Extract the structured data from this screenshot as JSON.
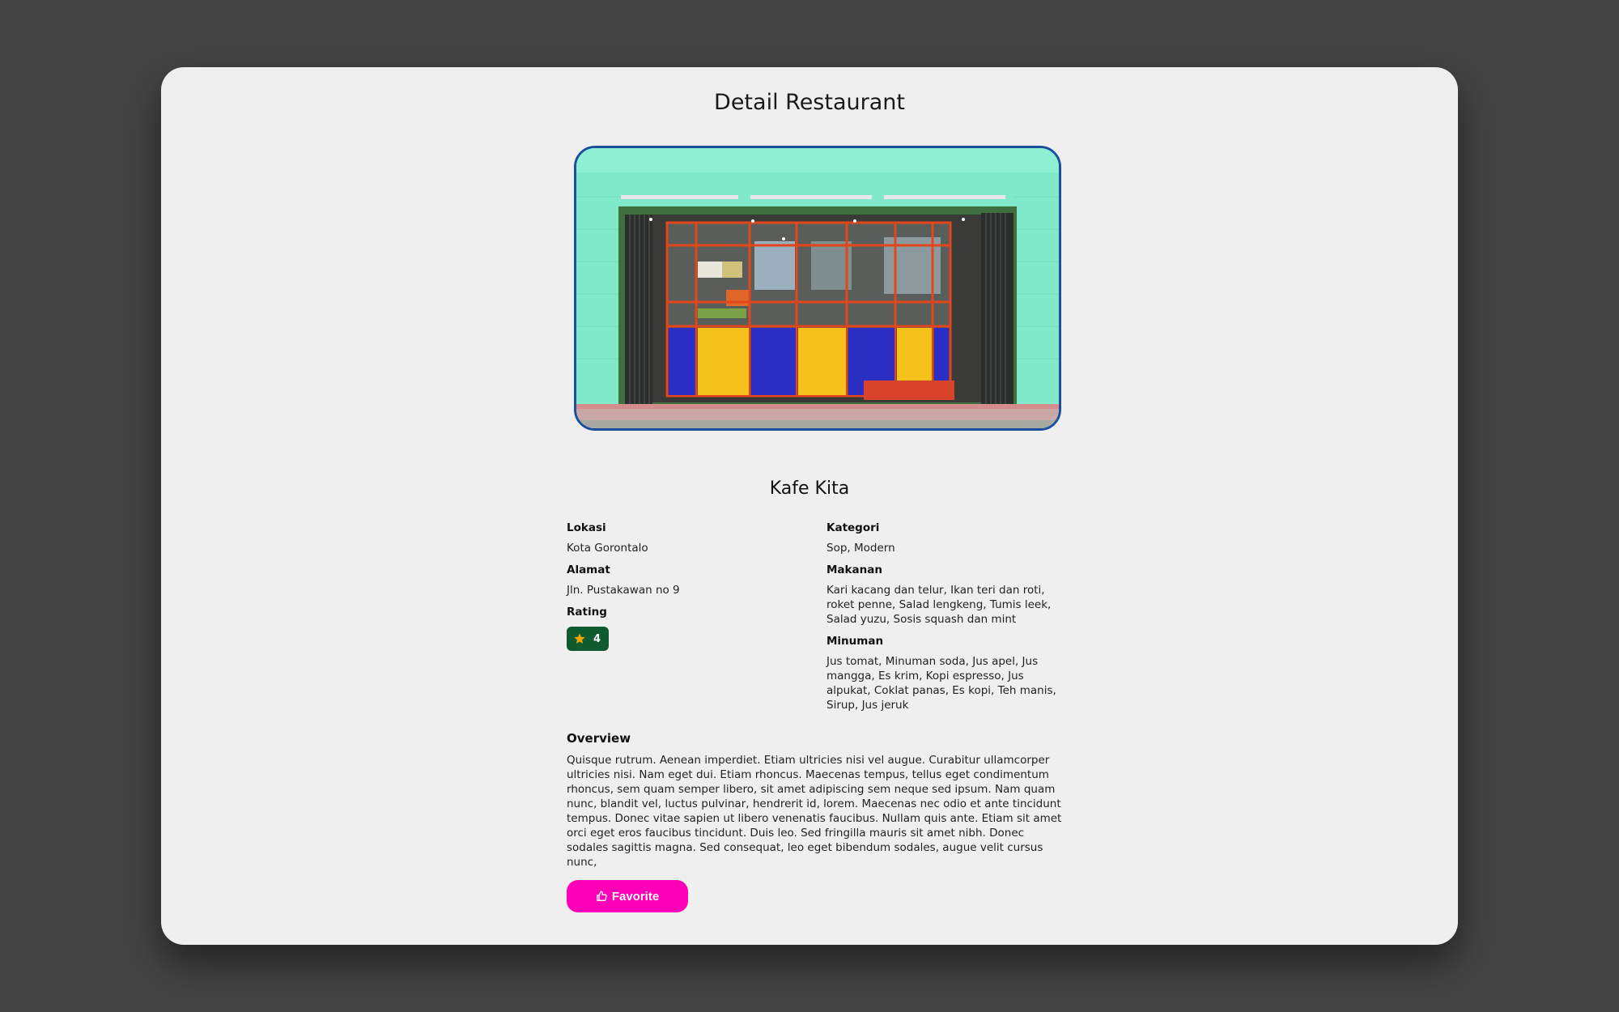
{
  "page": {
    "title": "Detail Restaurant"
  },
  "restaurant": {
    "image_alt": "Kafe Kita storefront",
    "name": "Kafe Kita",
    "lokasi_label": "Lokasi",
    "lokasi_value": "Kota Gorontalo",
    "alamat_label": "Alamat",
    "alamat_value": "Jln. Pustakawan no 9",
    "rating_label": "Rating",
    "rating_value": "4",
    "kategori_label": "Kategori",
    "kategori_value": "Sop, Modern",
    "makanan_label": "Makanan",
    "makanan_value": "Kari kacang dan telur, Ikan teri dan roti, roket penne, Salad lengkeng, Tumis leek, Salad yuzu, Sosis squash dan mint",
    "minuman_label": "Minuman",
    "minuman_value": "Jus tomat, Minuman soda, Jus apel, Jus mangga, Es krim, Kopi espresso, Jus alpukat, Coklat panas, Es kopi, Teh manis, Sirup, Jus jeruk"
  },
  "overview": {
    "heading": "Overview",
    "text": "Quisque rutrum. Aenean imperdiet. Etiam ultricies nisi vel augue. Curabitur ullamcorper ultricies nisi. Nam eget dui. Etiam rhoncus. Maecenas tempus, tellus eget condimentum rhoncus, sem quam semper libero, sit amet adipiscing sem neque sed ipsum. Nam quam nunc, blandit vel, luctus pulvinar, hendrerit id, lorem. Maecenas nec odio et ante tincidunt tempus. Donec vitae sapien ut libero venenatis faucibus. Nullam quis ante. Etiam sit amet orci eget eros faucibus tincidunt. Duis leo. Sed fringilla mauris sit amet nibh. Donec sodales sagittis magna. Sed consequat, leo eget bibendum sodales, augue velit cursus nunc,"
  },
  "actions": {
    "favorite_label": "Favorite"
  },
  "icons": {
    "rating": "star-icon",
    "favorite": "thumbs-up-icon"
  },
  "colors": {
    "background": "#444444",
    "card": "#efefef",
    "image_border": "#1b4f9e",
    "rating_badge": "#0f5a2e",
    "star": "#f0a500",
    "favorite_button": "#ff00b8"
  }
}
